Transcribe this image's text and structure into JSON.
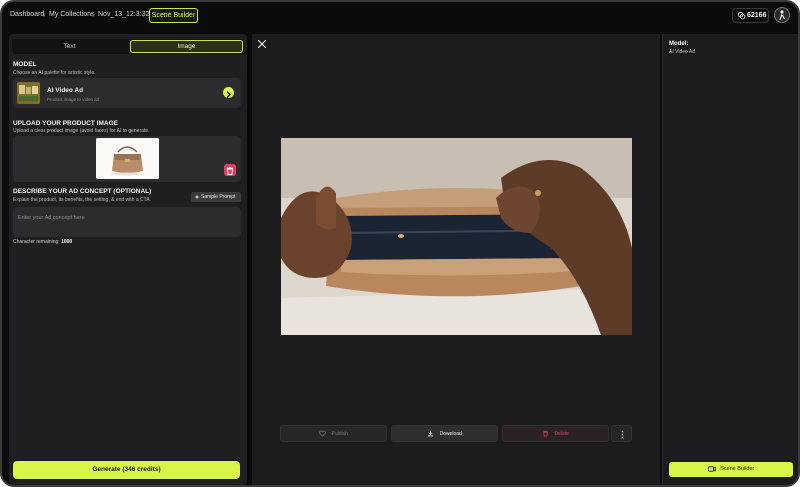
{
  "breadcrumb": {
    "items": [
      "Dashboard",
      "My Collections",
      "Nov_13_12:3:32"
    ],
    "active": "Scene Builder"
  },
  "credits": {
    "value": "62166"
  },
  "left_panel": {
    "tabs": [
      {
        "label": "Text"
      },
      {
        "label": "Image"
      }
    ],
    "active_tab": "Image",
    "model_section": {
      "title": "MODEL",
      "subtitle": "Choose an AI palette for artistic style.",
      "model_name": "AI Video Ad",
      "model_description": "Product image to video ad"
    },
    "upload_section": {
      "title": "UPLOAD YOUR PRODUCT IMAGE",
      "subtitle": "Upload a clear product image (avoid faces) for AI to generate."
    },
    "concept_section": {
      "title": "DESCRIBE YOUR AD CONCEPT (OPTIONAL)",
      "subtitle": "Explain the product, its benefits, the setting, & end with a CTA.",
      "sample_button": "Sample Prompt",
      "placeholder": "Enter your Ad concept here",
      "char_label": "Character remaining:",
      "char_value": "1000"
    },
    "generate_button": "Generate (346 credits)"
  },
  "preview": {
    "actions": {
      "publish": "Publish",
      "download": "Download",
      "delete": "Delete"
    }
  },
  "right_panel": {
    "model_label": "Model:",
    "model_value": "AI Video Ad",
    "scene_button": "Scene Builder"
  },
  "colors": {
    "accent": "#d8f54a",
    "danger": "#e0415f",
    "background": "#0b0b0b",
    "panel": "#1f1f21"
  }
}
